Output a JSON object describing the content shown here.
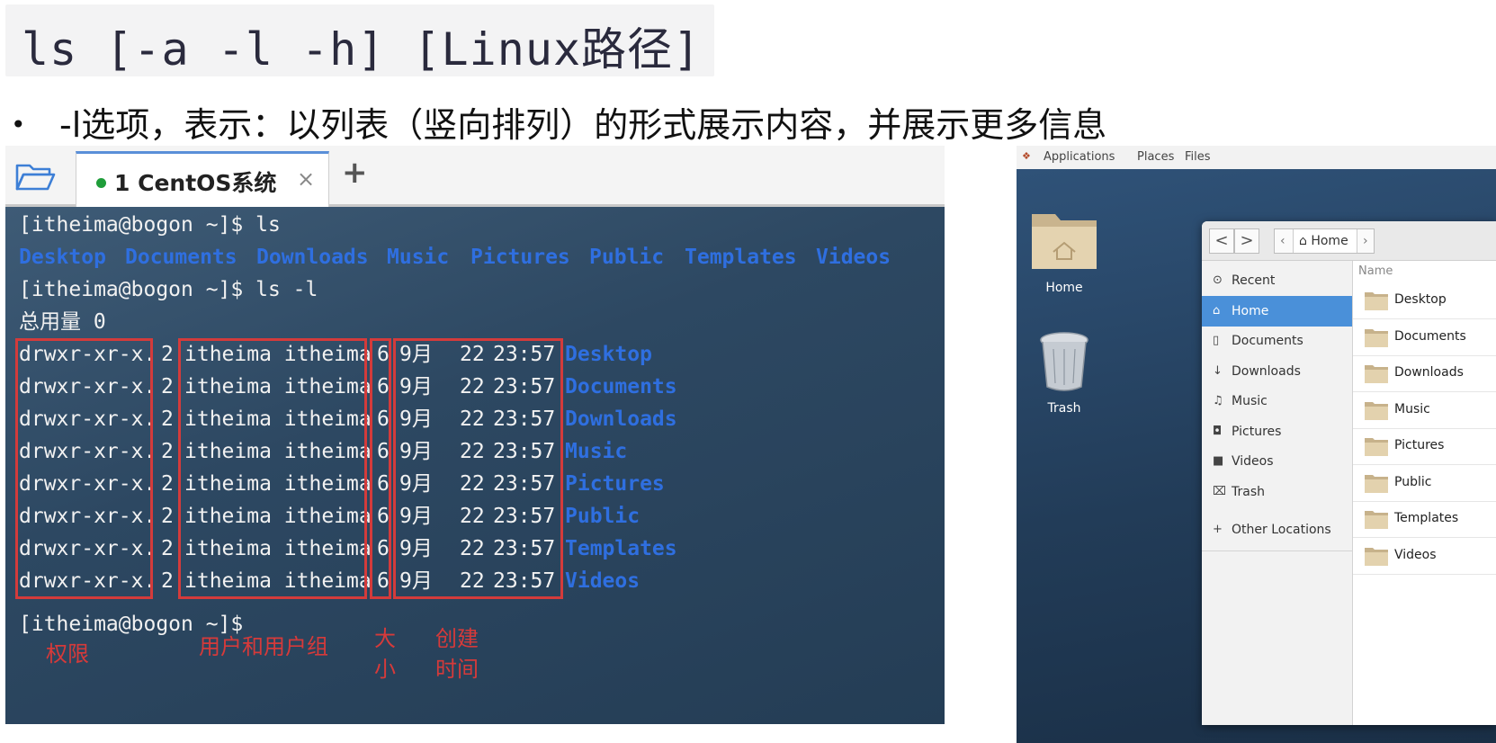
{
  "slide": {
    "command": "ls [-a -l -h] [Linux路径]",
    "bullet": "-l选项，表示：以列表（竖向排列）的形式展示内容，并展示更多信息"
  },
  "terminal": {
    "tab_title": "1 CentOS系统",
    "tab_close": "×",
    "tab_add": "+",
    "line1": "[itheima@bogon ~]$ ls",
    "dirs": [
      "Desktop",
      "Documents",
      "Downloads",
      "Music",
      "Pictures",
      "Public",
      "Templates",
      "Videos"
    ],
    "line3": "[itheima@bogon ~]$ ls -l",
    "total": "总用量 0",
    "rows": [
      {
        "perm": "drwxr-xr-x.",
        "links": "2",
        "owner": "itheima itheima",
        "size": "6",
        "month": "9月",
        "day": "22",
        "time": "23:57",
        "name": "Desktop"
      },
      {
        "perm": "drwxr-xr-x.",
        "links": "2",
        "owner": "itheima itheima",
        "size": "6",
        "month": "9月",
        "day": "22",
        "time": "23:57",
        "name": "Documents"
      },
      {
        "perm": "drwxr-xr-x.",
        "links": "2",
        "owner": "itheima itheima",
        "size": "6",
        "month": "9月",
        "day": "22",
        "time": "23:57",
        "name": "Downloads"
      },
      {
        "perm": "drwxr-xr-x.",
        "links": "2",
        "owner": "itheima itheima",
        "size": "6",
        "month": "9月",
        "day": "22",
        "time": "23:57",
        "name": "Music"
      },
      {
        "perm": "drwxr-xr-x.",
        "links": "2",
        "owner": "itheima itheima",
        "size": "6",
        "month": "9月",
        "day": "22",
        "time": "23:57",
        "name": "Pictures"
      },
      {
        "perm": "drwxr-xr-x.",
        "links": "2",
        "owner": "itheima itheima",
        "size": "6",
        "month": "9月",
        "day": "22",
        "time": "23:57",
        "name": "Public"
      },
      {
        "perm": "drwxr-xr-x.",
        "links": "2",
        "owner": "itheima itheima",
        "size": "6",
        "month": "9月",
        "day": "22",
        "time": "23:57",
        "name": "Templates"
      },
      {
        "perm": "drwxr-xr-x.",
        "links": "2",
        "owner": "itheima itheima",
        "size": "6",
        "month": "9月",
        "day": "22",
        "time": "23:57",
        "name": "Videos"
      }
    ],
    "prompt_end": "[itheima@bogon ~]$",
    "annotations": {
      "perm": "权限",
      "owner": "用户和用户组",
      "size_1": "大",
      "size_2": "小",
      "time_1": "创建",
      "time_2": "时间"
    }
  },
  "desktop": {
    "topbar": {
      "applications": "Applications",
      "places": "Places",
      "files": "Files"
    },
    "icons": {
      "home": "Home",
      "trash": "Trash"
    },
    "file_manager": {
      "back": "<",
      "forward": ">",
      "path_left": "‹",
      "path_label": "⌂ Home",
      "path_right": "›",
      "sidebar": [
        {
          "icon": "⊙",
          "label": "Recent"
        },
        {
          "icon": "⌂",
          "label": "Home"
        },
        {
          "icon": "▯",
          "label": "Documents"
        },
        {
          "icon": "↓",
          "label": "Downloads"
        },
        {
          "icon": "♫",
          "label": "Music"
        },
        {
          "icon": "◘",
          "label": "Pictures"
        },
        {
          "icon": "■",
          "label": "Videos"
        },
        {
          "icon": "⌧",
          "label": "Trash"
        },
        {
          "icon": "+",
          "label": "Other Locations"
        }
      ],
      "column_header": "Name",
      "files": [
        "Desktop",
        "Documents",
        "Downloads",
        "Music",
        "Pictures",
        "Public",
        "Templates",
        "Videos"
      ]
    }
  },
  "colors": {
    "dir_blue": "#2f6fe0",
    "annotation_red": "#d43b3b",
    "sidebar_active": "#4a90d9",
    "status_dot": "#1f9d3a"
  }
}
